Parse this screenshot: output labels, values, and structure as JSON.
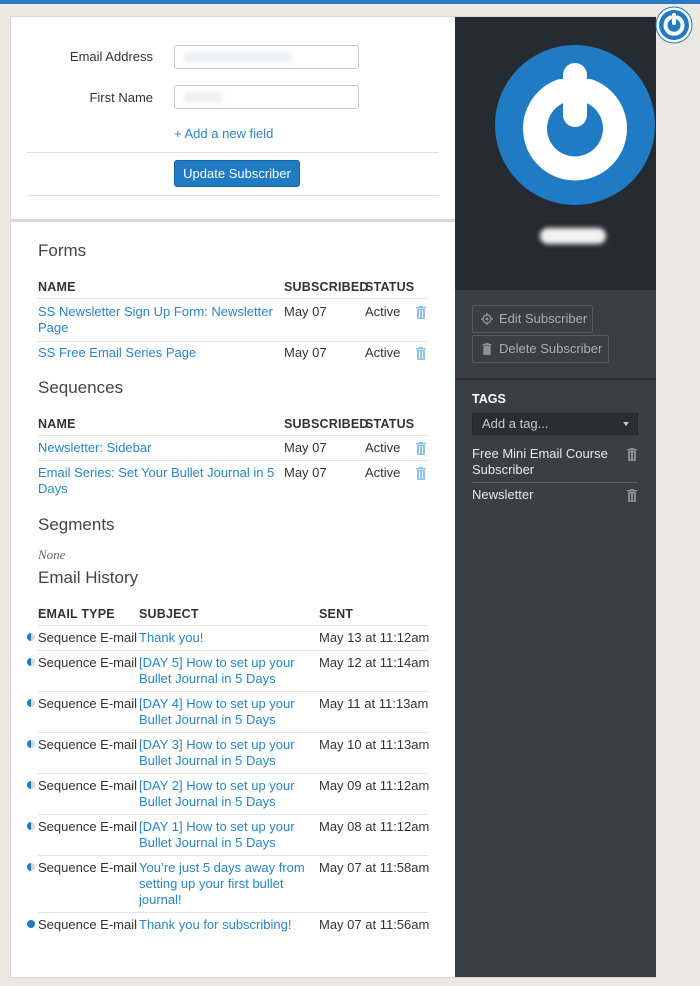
{
  "colors": {
    "brand_blue": "#1f7bc4",
    "link": "#2a85c6",
    "sidebar_dark": "#262b31",
    "sidebar": "#3a3f44"
  },
  "icons": {
    "app_logo": "power-logo-icon",
    "trash": "trash-icon",
    "gear": "gear-icon",
    "email_status": "half-circle-icon"
  },
  "form": {
    "email_label": "Email Address",
    "first_name_label": "First Name",
    "add_field": "+ Add a new field",
    "update_button": "Update Subscriber"
  },
  "forms_section": {
    "title": "Forms",
    "headers": {
      "name": "NAME",
      "subscribed": "SUBSCRIBED",
      "status": "STATUS"
    },
    "rows": [
      {
        "name_line1": "SS Newsletter Sign Up Form: Newsletter",
        "name_line2": "Page",
        "date": "May 07",
        "status": "Active"
      },
      {
        "name_line1": "SS Free Email Series Page",
        "name_line2": "",
        "date": "May 07",
        "status": "Active"
      }
    ]
  },
  "sequences_section": {
    "title": "Sequences",
    "headers": {
      "name": "NAME",
      "subscribed": "SUBSCRIBED",
      "status": "STATUS"
    },
    "rows": [
      {
        "name_line1": "Newsletter: Sidebar",
        "name_line2": "",
        "date": "May 07",
        "status": "Active"
      },
      {
        "name_line1": "Email Series: Set Your Bullet Journal in 5",
        "name_line2": "Days",
        "date": "May 07",
        "status": "Active"
      }
    ]
  },
  "segments_section": {
    "title": "Segments",
    "none": "None"
  },
  "history_section": {
    "title": "Email History",
    "headers": {
      "type": "EMAIL TYPE",
      "subject": "SUBJECT",
      "sent": "SENT"
    },
    "rows": [
      {
        "type": "Sequence E-mail",
        "subject": [
          "Thank you!"
        ],
        "sent": "May 13 at 11:12am"
      },
      {
        "type": "Sequence E-mail",
        "subject": [
          "[DAY 5] How to set up your",
          "Bullet Journal in 5 Days"
        ],
        "sent": "May 12 at 11:14am"
      },
      {
        "type": "Sequence E-mail",
        "subject": [
          "[DAY 4] How to set up your",
          "Bullet Journal in 5 Days"
        ],
        "sent": "May 11 at 11:13am"
      },
      {
        "type": "Sequence E-mail",
        "subject": [
          "[DAY 3] How to set up your",
          "Bullet Journal in 5 Days"
        ],
        "sent": "May 10 at 11:13am"
      },
      {
        "type": "Sequence E-mail",
        "subject": [
          "[DAY 2] How to set up your",
          "Bullet Journal in 5 Days"
        ],
        "sent": "May 09 at 11:12am"
      },
      {
        "type": "Sequence E-mail",
        "subject": [
          "[DAY 1] How to set up your",
          "Bullet Journal in 5 Days"
        ],
        "sent": "May 08 at 11:12am"
      },
      {
        "type": "Sequence E-mail",
        "subject": [
          "You’re just 5 days away from",
          "setting up your first bullet",
          "journal!"
        ],
        "sent": "May 07 at 11:58am"
      },
      {
        "type": "Sequence E-mail",
        "subject": [
          "Thank you for subscribing!"
        ],
        "sent": "May 07 at 11:56am"
      }
    ]
  },
  "sidebar": {
    "edit_button": "Edit Subscriber",
    "delete_button": "Delete Subscriber",
    "tags_title": "TAGS",
    "tag_placeholder": "Add a tag...",
    "tags": [
      {
        "line1": "Free Mini Email Course",
        "line2": "Subscriber"
      },
      {
        "line1": "Newsletter",
        "line2": ""
      }
    ]
  }
}
